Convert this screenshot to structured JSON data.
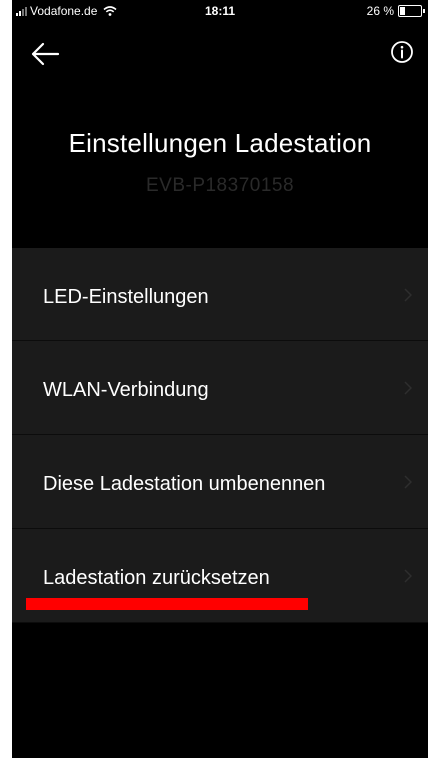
{
  "status_bar": {
    "carrier": "Vodafone.de",
    "time": "18:11",
    "battery": "26 %",
    "battery_level": 0.26
  },
  "nav": {
    "back_icon": "arrow-left-icon",
    "info_icon": "info-icon"
  },
  "header": {
    "title": "Einstellungen Ladestation",
    "subtitle": "EVB-P18370158"
  },
  "menu": {
    "items": [
      {
        "label": "LED-Einstellungen"
      },
      {
        "label": "WLAN-Verbindung"
      },
      {
        "label": "Diese Ladestation umbenennen"
      },
      {
        "label": "Ladestation zurücksetzen"
      }
    ]
  },
  "colors": {
    "background": "#000000",
    "menu_background": "#1b1b1b",
    "highlight": "#ff0000"
  }
}
